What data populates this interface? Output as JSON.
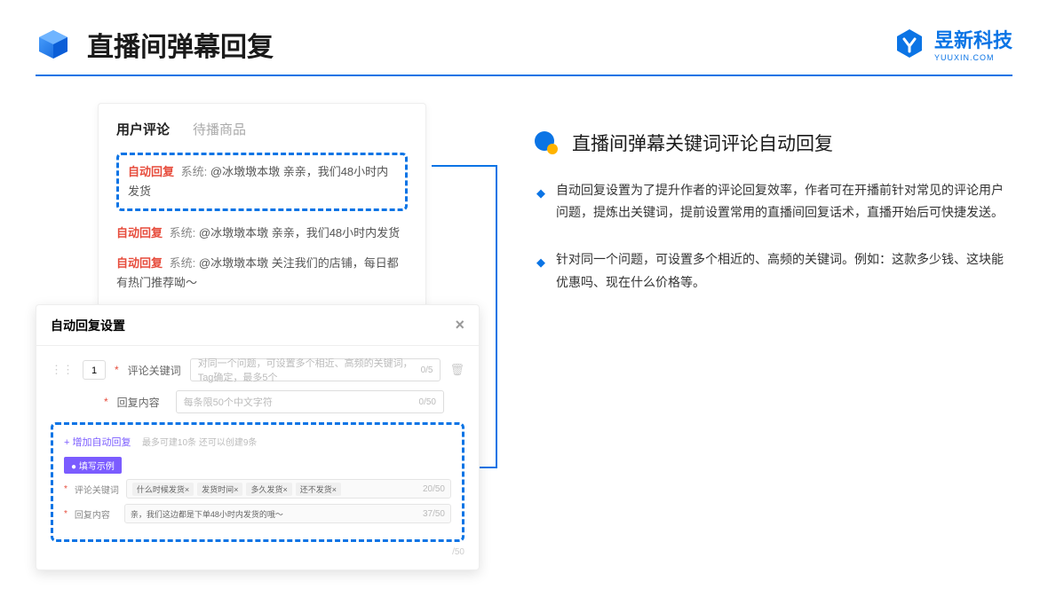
{
  "header": {
    "title": "直播间弹幕回复"
  },
  "brand": {
    "name": "昱新科技",
    "sub": "YUUXIN.COM"
  },
  "commentCard": {
    "tab1": "用户评论",
    "tab2": "待播商品",
    "autoTag": "自动回复",
    "sys": "系统:",
    "c1": "@冰墩墩本墩 亲亲，我们48小时内发货",
    "c2": "@冰墩墩本墩 亲亲，我们48小时内发货",
    "c3": "@冰墩墩本墩 关注我们的店铺，每日都有热门推荐呦～"
  },
  "settings": {
    "title": "自动回复设置",
    "num": "1",
    "kwLabel": "评论关键词",
    "kwPlaceholder": "对同一个问题，可设置多个相近、高频的关键词，Tag确定，最多5个",
    "kwCount": "0/5",
    "replyLabel": "回复内容",
    "replyPlaceholder": "每条限50个中文字符",
    "replyCount": "0/50",
    "addLink": "+ 增加自动回复",
    "addHint": "最多可建10条 还可以创建9条",
    "badge": "● 填写示例",
    "exKwLabel": "评论关键词",
    "exTags": [
      "什么时候发货×",
      "发货时间×",
      "多久发货×",
      "还不发货×"
    ],
    "exKwCount": "20/50",
    "exReplyLabel": "回复内容",
    "exReplyText": "亲，我们这边都是下单48小时内发货的哦～",
    "exReplyCount": "37/50",
    "bottomCount": "/50"
  },
  "right": {
    "title": "直播间弹幕关键词评论自动回复",
    "b1": "自动回复设置为了提升作者的评论回复效率，作者可在开播前针对常见的评论用户问题，提炼出关键词，提前设置常用的直播间回复话术，直播开始后可快捷发送。",
    "b2": "针对同一个问题，可设置多个相近的、高频的关键词。例如：这款多少钱、这块能优惠吗、现在什么价格等。"
  }
}
